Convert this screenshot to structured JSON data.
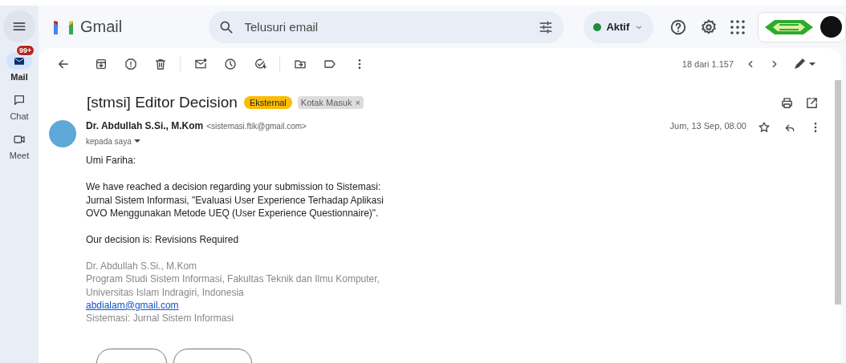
{
  "header": {
    "app_name": "Gmail",
    "search": {
      "placeholder": "Telusuri email"
    },
    "status": {
      "label": "Aktif"
    }
  },
  "nav_rail": [
    {
      "label": "Mail",
      "badge": "99+",
      "selected": true
    },
    {
      "label": "Chat",
      "selected": false
    },
    {
      "label": "Meet",
      "selected": false
    }
  ],
  "toolbar": {
    "pagination": "18 dari 1.157"
  },
  "message": {
    "subject": "[stmsi] Editor Decision",
    "labels": [
      {
        "text": "Eksternal",
        "kind": "external"
      },
      {
        "text": "Kotak Masuk",
        "kind": "inbox",
        "close": "×"
      }
    ],
    "sender_name": "Dr. Abdullah S.Si., M.Kom",
    "sender_email": "<sistemasi.ftik@gmail.com>",
    "recipient": "kepada saya",
    "date": "Jum, 13 Sep, 08.00",
    "body": [
      "Umi Fariha:",
      "We have reached a decision regarding your submission to Sistemasi: Jurnal Sistem Informasi, \"Evaluasi User Experience Terhadap Aplikasi OVO Menggunakan Metode UEQ (User Experience Questionnaire)\".",
      "Our decision is: Revisions Required"
    ],
    "signature": [
      {
        "text": "Dr. Abdullah S.Si., M.Kom",
        "kind": "text"
      },
      {
        "text": "Program Studi Sistem Informasi, Fakultas Teknik dan Ilmu Komputer,",
        "kind": "text"
      },
      {
        "text": "Universitas Islam Indragiri, Indonesia",
        "kind": "text"
      },
      {
        "text": "abdialam@gmail.com",
        "kind": "link"
      },
      {
        "text": "Sistemasi: Jurnal Sistem Informasi",
        "kind": "text"
      }
    ]
  }
}
